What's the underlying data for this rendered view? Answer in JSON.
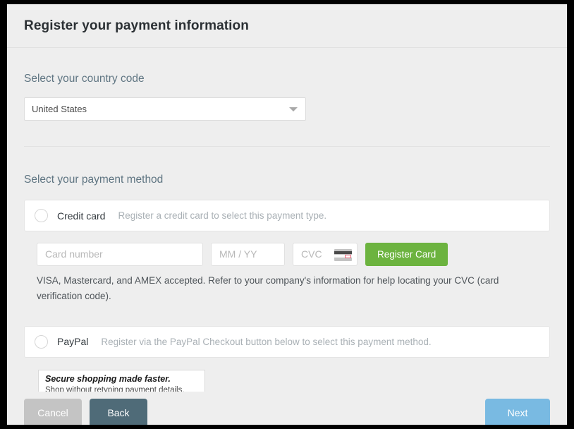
{
  "header": {
    "title": "Register your payment information"
  },
  "country": {
    "label": "Select your country code",
    "selected": "United States",
    "caret_icon": "chevron-down-icon"
  },
  "payment": {
    "label": "Select your payment method",
    "credit_card": {
      "name": "Credit card",
      "description": "Register a credit card to select this payment type.",
      "radio_selected": false,
      "fields": {
        "card_number_placeholder": "Card number",
        "card_number_value": "",
        "expiry_placeholder": "MM / YY",
        "expiry_value": "",
        "cvc_placeholder": "CVC",
        "cvc_value": "",
        "cvc_hint_icon": "credit-card-icon"
      },
      "register_button": "Register Card",
      "help_text": "VISA, Mastercard, and AMEX accepted. Refer to your company's information for help locating your CVC (card verification code)."
    },
    "paypal": {
      "name": "PayPal",
      "description": "Register via the PayPal Checkout button below to select this payment method.",
      "radio_selected": false,
      "banner": {
        "headline": "Secure shopping made faster.",
        "subline": "Shop without retyping payment details."
      }
    }
  },
  "footer": {
    "cancel_label": "Cancel",
    "back_label": "Back",
    "next_label": "Next"
  },
  "colors": {
    "accent_green": "#6cb33f",
    "accent_blue": "#79bae2",
    "back_slate": "#4f6b78",
    "cancel_grey": "#c4c4c4",
    "section_label": "#5f7582",
    "cvc_highlight": "#e8657a"
  }
}
